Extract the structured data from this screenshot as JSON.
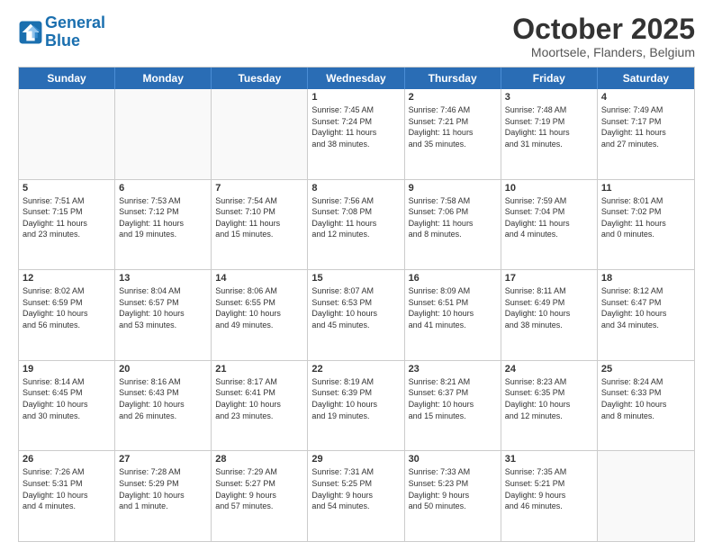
{
  "header": {
    "logo_line1": "General",
    "logo_line2": "Blue",
    "month": "October 2025",
    "location": "Moortsele, Flanders, Belgium"
  },
  "days": [
    "Sunday",
    "Monday",
    "Tuesday",
    "Wednesday",
    "Thursday",
    "Friday",
    "Saturday"
  ],
  "weeks": [
    [
      {
        "day": "",
        "text": ""
      },
      {
        "day": "",
        "text": ""
      },
      {
        "day": "",
        "text": ""
      },
      {
        "day": "1",
        "text": "Sunrise: 7:45 AM\nSunset: 7:24 PM\nDaylight: 11 hours\nand 38 minutes."
      },
      {
        "day": "2",
        "text": "Sunrise: 7:46 AM\nSunset: 7:21 PM\nDaylight: 11 hours\nand 35 minutes."
      },
      {
        "day": "3",
        "text": "Sunrise: 7:48 AM\nSunset: 7:19 PM\nDaylight: 11 hours\nand 31 minutes."
      },
      {
        "day": "4",
        "text": "Sunrise: 7:49 AM\nSunset: 7:17 PM\nDaylight: 11 hours\nand 27 minutes."
      }
    ],
    [
      {
        "day": "5",
        "text": "Sunrise: 7:51 AM\nSunset: 7:15 PM\nDaylight: 11 hours\nand 23 minutes."
      },
      {
        "day": "6",
        "text": "Sunrise: 7:53 AM\nSunset: 7:12 PM\nDaylight: 11 hours\nand 19 minutes."
      },
      {
        "day": "7",
        "text": "Sunrise: 7:54 AM\nSunset: 7:10 PM\nDaylight: 11 hours\nand 15 minutes."
      },
      {
        "day": "8",
        "text": "Sunrise: 7:56 AM\nSunset: 7:08 PM\nDaylight: 11 hours\nand 12 minutes."
      },
      {
        "day": "9",
        "text": "Sunrise: 7:58 AM\nSunset: 7:06 PM\nDaylight: 11 hours\nand 8 minutes."
      },
      {
        "day": "10",
        "text": "Sunrise: 7:59 AM\nSunset: 7:04 PM\nDaylight: 11 hours\nand 4 minutes."
      },
      {
        "day": "11",
        "text": "Sunrise: 8:01 AM\nSunset: 7:02 PM\nDaylight: 11 hours\nand 0 minutes."
      }
    ],
    [
      {
        "day": "12",
        "text": "Sunrise: 8:02 AM\nSunset: 6:59 PM\nDaylight: 10 hours\nand 56 minutes."
      },
      {
        "day": "13",
        "text": "Sunrise: 8:04 AM\nSunset: 6:57 PM\nDaylight: 10 hours\nand 53 minutes."
      },
      {
        "day": "14",
        "text": "Sunrise: 8:06 AM\nSunset: 6:55 PM\nDaylight: 10 hours\nand 49 minutes."
      },
      {
        "day": "15",
        "text": "Sunrise: 8:07 AM\nSunset: 6:53 PM\nDaylight: 10 hours\nand 45 minutes."
      },
      {
        "day": "16",
        "text": "Sunrise: 8:09 AM\nSunset: 6:51 PM\nDaylight: 10 hours\nand 41 minutes."
      },
      {
        "day": "17",
        "text": "Sunrise: 8:11 AM\nSunset: 6:49 PM\nDaylight: 10 hours\nand 38 minutes."
      },
      {
        "day": "18",
        "text": "Sunrise: 8:12 AM\nSunset: 6:47 PM\nDaylight: 10 hours\nand 34 minutes."
      }
    ],
    [
      {
        "day": "19",
        "text": "Sunrise: 8:14 AM\nSunset: 6:45 PM\nDaylight: 10 hours\nand 30 minutes."
      },
      {
        "day": "20",
        "text": "Sunrise: 8:16 AM\nSunset: 6:43 PM\nDaylight: 10 hours\nand 26 minutes."
      },
      {
        "day": "21",
        "text": "Sunrise: 8:17 AM\nSunset: 6:41 PM\nDaylight: 10 hours\nand 23 minutes."
      },
      {
        "day": "22",
        "text": "Sunrise: 8:19 AM\nSunset: 6:39 PM\nDaylight: 10 hours\nand 19 minutes."
      },
      {
        "day": "23",
        "text": "Sunrise: 8:21 AM\nSunset: 6:37 PM\nDaylight: 10 hours\nand 15 minutes."
      },
      {
        "day": "24",
        "text": "Sunrise: 8:23 AM\nSunset: 6:35 PM\nDaylight: 10 hours\nand 12 minutes."
      },
      {
        "day": "25",
        "text": "Sunrise: 8:24 AM\nSunset: 6:33 PM\nDaylight: 10 hours\nand 8 minutes."
      }
    ],
    [
      {
        "day": "26",
        "text": "Sunrise: 7:26 AM\nSunset: 5:31 PM\nDaylight: 10 hours\nand 4 minutes."
      },
      {
        "day": "27",
        "text": "Sunrise: 7:28 AM\nSunset: 5:29 PM\nDaylight: 10 hours\nand 1 minute."
      },
      {
        "day": "28",
        "text": "Sunrise: 7:29 AM\nSunset: 5:27 PM\nDaylight: 9 hours\nand 57 minutes."
      },
      {
        "day": "29",
        "text": "Sunrise: 7:31 AM\nSunset: 5:25 PM\nDaylight: 9 hours\nand 54 minutes."
      },
      {
        "day": "30",
        "text": "Sunrise: 7:33 AM\nSunset: 5:23 PM\nDaylight: 9 hours\nand 50 minutes."
      },
      {
        "day": "31",
        "text": "Sunrise: 7:35 AM\nSunset: 5:21 PM\nDaylight: 9 hours\nand 46 minutes."
      },
      {
        "day": "",
        "text": ""
      }
    ]
  ]
}
